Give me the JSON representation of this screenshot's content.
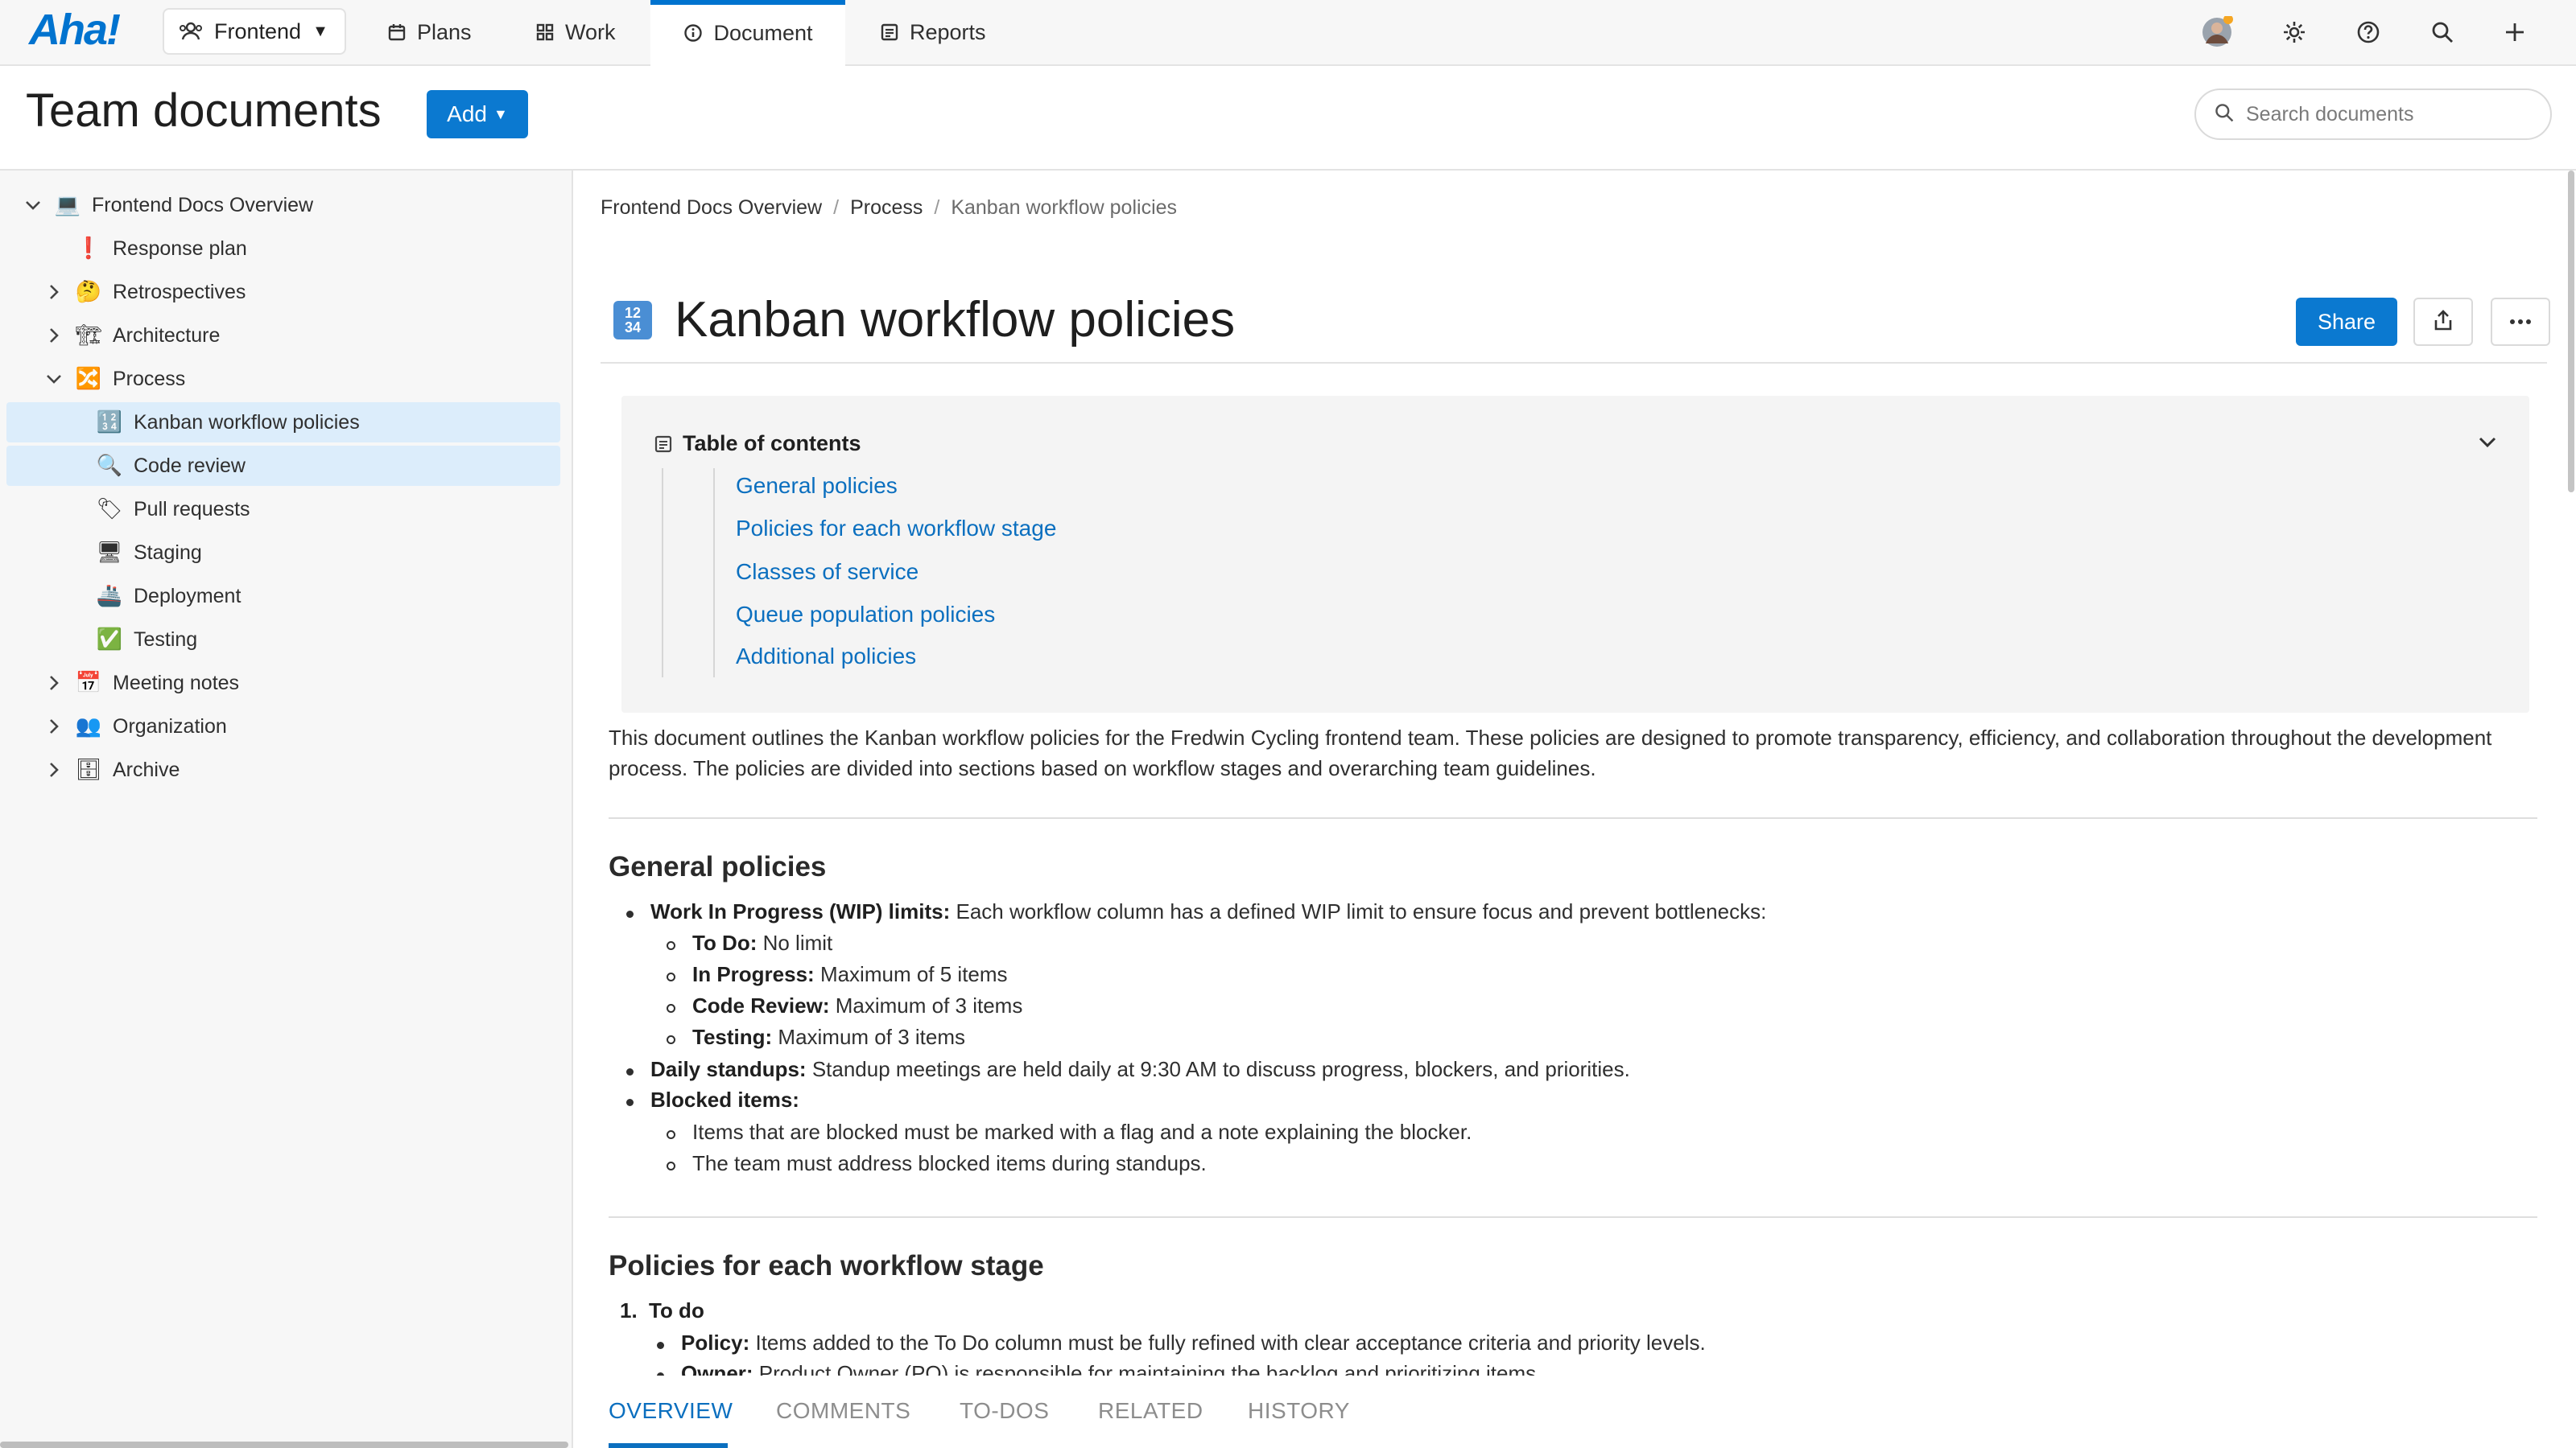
{
  "app": {
    "logo": "Aha!"
  },
  "workspace": {
    "label": "Frontend"
  },
  "nav": {
    "tabs": [
      {
        "label": "Plans",
        "icon": "calendar-icon"
      },
      {
        "label": "Work",
        "icon": "grid-icon"
      },
      {
        "label": "Document",
        "icon": "info-icon"
      },
      {
        "label": "Reports",
        "icon": "list-icon"
      }
    ],
    "active_tab": "Document",
    "right_icons": [
      "avatar",
      "gear-icon",
      "help-icon",
      "search-icon",
      "plus-icon"
    ]
  },
  "header": {
    "title": "Team documents",
    "add_label": "Add",
    "search_placeholder": "Search documents"
  },
  "sidebar": {
    "items": [
      {
        "label": "Frontend Docs Overview",
        "emoji": "💻",
        "expand": "open"
      },
      {
        "label": "Response plan",
        "emoji": "❗",
        "expand": "none"
      },
      {
        "label": "Retrospectives",
        "emoji": "🤔",
        "expand": "closed"
      },
      {
        "label": "Architecture",
        "emoji": "🏗",
        "expand": "closed"
      },
      {
        "label": "Process",
        "emoji": "🔀",
        "expand": "open"
      },
      {
        "label": "Kanban workflow policies",
        "emoji": "🔢",
        "expand": "none"
      },
      {
        "label": "Code review",
        "emoji": "🔍",
        "expand": "none"
      },
      {
        "label": "Pull requests",
        "emoji": "🏷",
        "expand": "none"
      },
      {
        "label": "Staging",
        "emoji": "🖥",
        "expand": "none"
      },
      {
        "label": "Deployment",
        "emoji": "🚢",
        "expand": "none"
      },
      {
        "label": "Testing",
        "emoji": "✅",
        "expand": "none"
      },
      {
        "label": "Meeting notes",
        "emoji": "📅",
        "expand": "closed"
      },
      {
        "label": "Organization",
        "emoji": "👥",
        "expand": "closed"
      },
      {
        "label": "Archive",
        "emoji": "🗄",
        "expand": "closed"
      }
    ]
  },
  "breadcrumb": {
    "items": [
      "Frontend Docs Overview",
      "Process",
      "Kanban workflow policies"
    ],
    "separator": "/"
  },
  "document": {
    "title": "Kanban workflow policies",
    "title_icon": "🔢",
    "share_label": "Share",
    "toc": {
      "title": "Table of contents",
      "links": [
        "General policies",
        "Policies for each workflow stage",
        "Classes of service",
        "Queue population policies",
        "Additional policies"
      ]
    },
    "intro": "This document outlines the Kanban workflow policies for the Fredwin Cycling frontend team. These policies are designed to promote transparency, efficiency, and collaboration throughout the development process. The policies are divided into sections based on workflow stages and overarching team guidelines.",
    "general": {
      "heading": "General policies",
      "wip_label": "Work In Progress (WIP) limits:",
      "wip_text": " Each workflow column has a defined WIP limit to ensure focus and prevent bottlenecks:",
      "wip_items": [
        {
          "label": "To Do:",
          "text": " No limit"
        },
        {
          "label": "In Progress:",
          "text": " Maximum of 5 items"
        },
        {
          "label": "Code Review:",
          "text": " Maximum of 3 items"
        },
        {
          "label": "Testing:",
          "text": " Maximum of 3 items"
        }
      ],
      "standup_label": "Daily standups:",
      "standup_text": " Standup meetings are held daily at 9:30 AM to discuss progress, blockers, and priorities.",
      "blocked_label": "Blocked items:",
      "blocked_items": [
        "Items that are blocked must be marked with a flag and a note explaining the blocker.",
        "The team must address blocked items during standups."
      ]
    },
    "stages": {
      "heading": "Policies for each workflow stage",
      "first_num": "1.",
      "first_title": "To do",
      "policy_label": "Policy:",
      "policy_text": " Items added to the To Do column must be fully refined with clear acceptance criteria and priority levels.",
      "owner_label": "Owner:",
      "owner_text": " Product Owner (PO) is responsible for maintaining the backlog and prioritizing items."
    }
  },
  "bottom_tabs": [
    "OVERVIEW",
    "COMMENTS",
    "TO-DOS",
    "RELATED",
    "HISTORY"
  ],
  "colors": {
    "accent": "#0b79d0",
    "link": "#0b6fbf",
    "selected_row": "#dcedfb"
  }
}
